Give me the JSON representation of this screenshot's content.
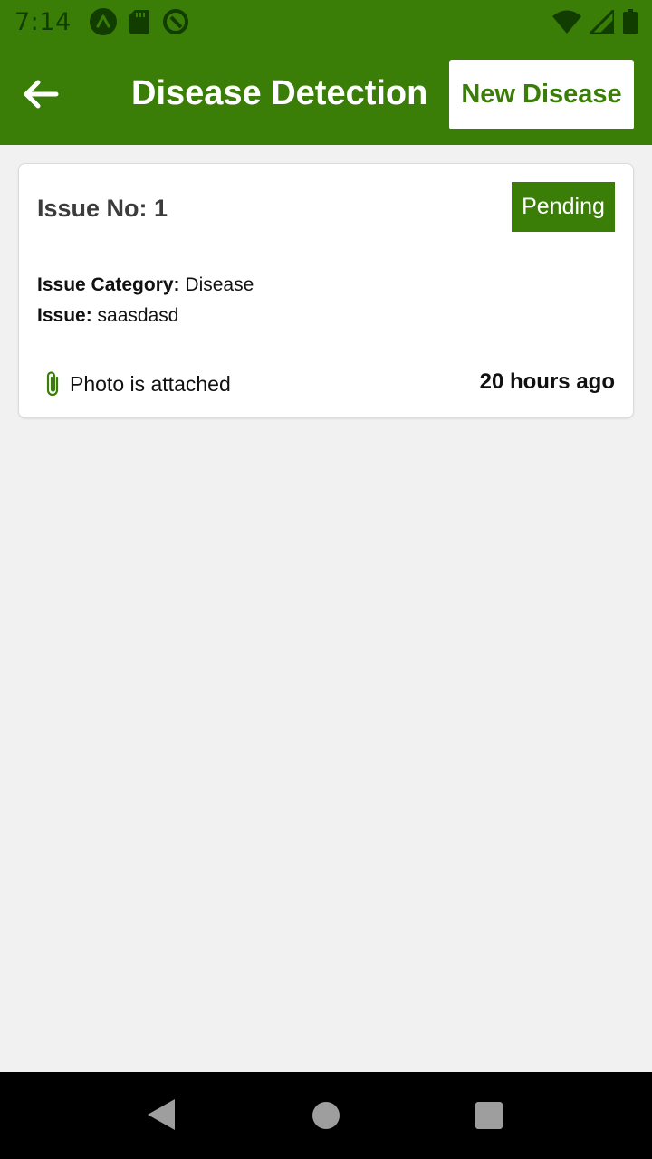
{
  "status_bar": {
    "time": "7:14",
    "icons_left": [
      "app-notification-icon",
      "sd-card-icon",
      "sync-icon"
    ],
    "icons_right": [
      "wifi-icon",
      "cellular-signal-icon",
      "battery-icon"
    ]
  },
  "app_bar": {
    "title": "Disease Detection",
    "new_button_label": "New Disease",
    "back_icon": "arrow-left-icon"
  },
  "issues": [
    {
      "issue_no_label": "Issue No: 1",
      "status": "Pending",
      "category_label": "Issue Category:",
      "category_value": "Disease",
      "issue_label": "Issue:",
      "issue_value": "saasdasd",
      "attachment_text": "Photo is attached",
      "time_ago": "20 hours ago"
    }
  ],
  "colors": {
    "primary": "#3a7d07",
    "background": "#f1f1f1",
    "card": "#ffffff"
  },
  "nav_bar": {
    "icons": [
      "nav-back-icon",
      "nav-home-icon",
      "nav-recents-icon"
    ]
  }
}
